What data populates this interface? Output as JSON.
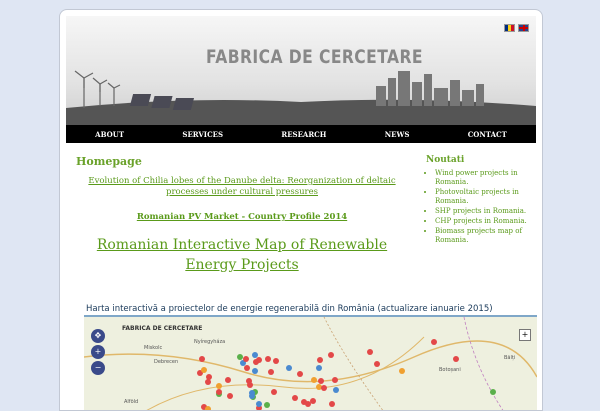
{
  "header": {
    "logo_text": "FABRICA DE CERCETARE"
  },
  "nav": {
    "items": [
      "ABOUT",
      "SERVICES",
      "RESEARCH",
      "NEWS",
      "CONTACT"
    ]
  },
  "main": {
    "title": "Homepage",
    "links": [
      "Evolution of Chilia lobes of the Danube delta: Reorganization of deltaic processes under cultural pressures",
      "Romanian PV Market - Country Profile 2014",
      "Romanian Interactive Map of Renewable Energy Projects"
    ],
    "map_title": "Harta interactivă a proiectelor de energie regenerabilă din România (actualizare ianuarie 2015)",
    "map_banner": "FABRICA DE CERCETARE",
    "map_cities": [
      "Debrecen",
      "Nyíregyháza",
      "Miskolc",
      "Bălți",
      "Botoșani",
      "Alföld"
    ]
  },
  "sidebar": {
    "title": "Noutati",
    "items": [
      "Wind power projects in Romania.",
      "Photovoltaic projects in Romania.",
      "SHP projects in Romania.",
      "CHP projects in Romania.",
      "Biomass projects map of Romania."
    ]
  },
  "colors": {
    "accent": "#6aa22a",
    "nav_bg": "#000000"
  }
}
